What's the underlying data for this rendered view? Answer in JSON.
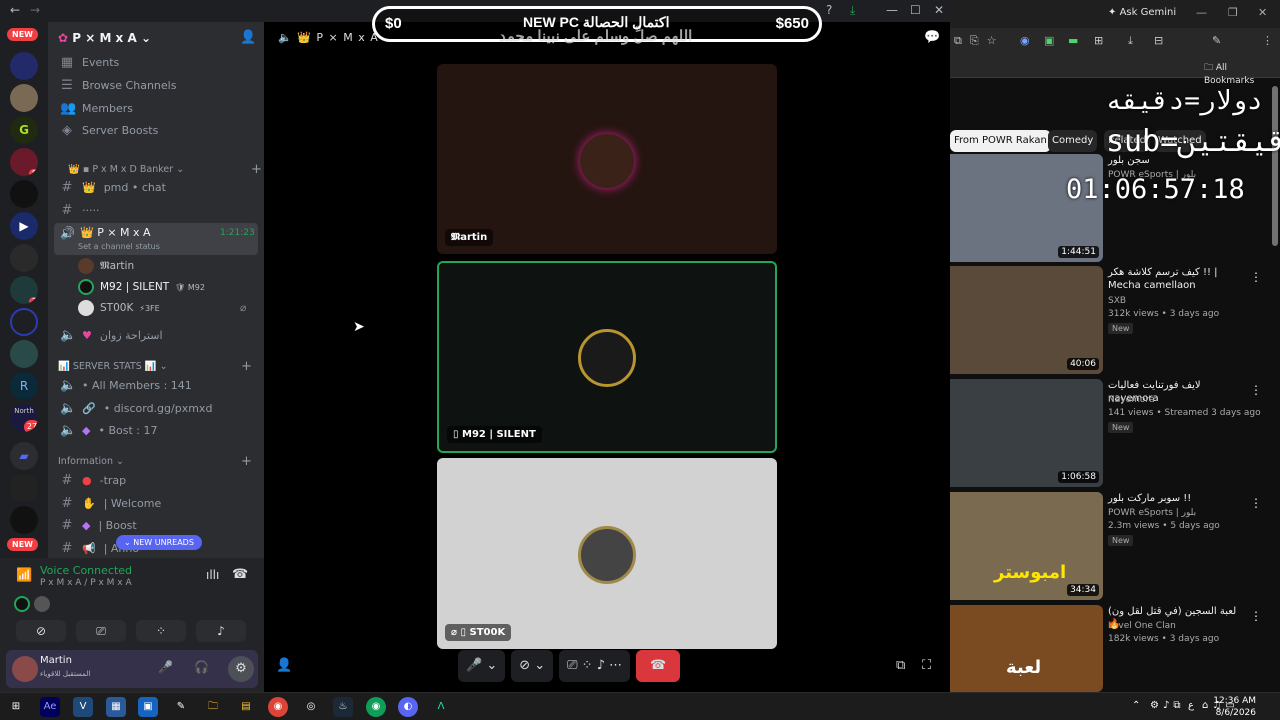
{
  "discord": {
    "server_name": "P × M x A",
    "new_label": "NEW",
    "menu": [
      "Events",
      "Browse Channels",
      "Members",
      "Server Boosts"
    ],
    "category1": "P x M x D Banker",
    "channels1": [
      {
        "name": "pmd • chat",
        "type": "text"
      },
      {
        "name": "·····",
        "type": "text"
      }
    ],
    "voice_channel": {
      "name": "P × M x A",
      "timer": "1:21:23",
      "status": "Set a channel status"
    },
    "voice_users": [
      {
        "name": "𝕸artin",
        "tag": ""
      },
      {
        "name": "M92 | SILENT",
        "tag": "M92"
      },
      {
        "name": "ST00K",
        "tag": "3FE"
      }
    ],
    "voice2": "استراحة زوان",
    "category2": "SERVER STATS",
    "stats": [
      "All Members : 141",
      "discord.gg/pxmxd",
      "Bost : 17"
    ],
    "category3": "Information",
    "info_channels": [
      "-trap",
      "Welcome",
      "Boost",
      "Anno"
    ],
    "new_unreads": "NEW UNREADS",
    "voice_connected": "Voice Connected",
    "voice_connected_sub": "P x M x A / P x M x A",
    "user": {
      "name": "Martin",
      "status": "المستقبل للاقوياء"
    },
    "server_badges": [
      "8",
      "2",
      "27"
    ],
    "server_label_north": "North"
  },
  "stage": {
    "header": "P × M x A",
    "tiles": [
      {
        "label": "𝕸artin",
        "mobile": false
      },
      {
        "label": "M92 | SILENT",
        "mobile": true
      },
      {
        "label": "ST00K",
        "mobile": true
      }
    ]
  },
  "banner": {
    "left": "$0",
    "right": "$650",
    "center": "NEW PC اكتمال الحصالة",
    "sub": "اللهم صلِّ وسلم على نبينا محمد"
  },
  "browser": {
    "ask_gemini": "Ask Gemini",
    "all_bookmarks": "All Bookmarks",
    "chips": [
      "From POWR Rakan",
      "Comedy",
      "Related",
      "Watched"
    ],
    "overlay": {
      "line1": "دولار=دقيقه",
      "line2": "sub=دقيقتين",
      "timer": "01:06:57:18"
    },
    "videos": [
      {
        "title": "سجن بلور",
        "channel": "POWR eSports | بلور",
        "meta": "",
        "duration": "1:44:51",
        "new": false
      },
      {
        "title": "كيف ترسم كلاشة هكر !! | Mecha camellaon",
        "channel": "SXB",
        "meta": "312k views • 3 days ago",
        "duration": "40:06",
        "new": true
      },
      {
        "title": "لايف فورتنايت فعاليات nayemora",
        "channel": "Nayemora",
        "meta": "141 views • Streamed 3 days ago",
        "duration": "1:06:58",
        "new": true
      },
      {
        "title": "سوبر ماركت بلور !!",
        "channel": "POWR eSports | بلور",
        "meta": "2.3m views • 5 days ago",
        "duration": "34:34",
        "new": true
      },
      {
        "title": "لعبة السجين (في قتل لقل ون) 🔥",
        "channel": "Level One Clan",
        "meta": "182k views • 3 days ago",
        "duration": "",
        "new": false
      }
    ],
    "thumb4_text": "امبوستر",
    "thumb5_text": "لعبة"
  },
  "taskbar": {
    "time": "12:36 AM",
    "date": "8/6/2026",
    "lang": "ع"
  }
}
